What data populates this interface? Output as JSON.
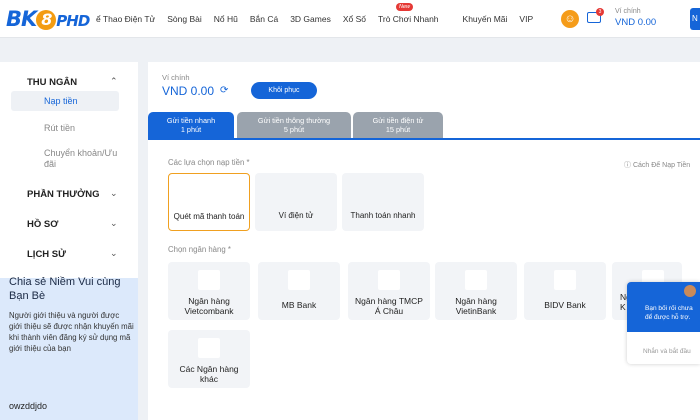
{
  "header": {
    "logo_a": "BK",
    "logo_eight": "8",
    "logo_b": "PHD",
    "nav": [
      "ể Thao Điện Tử",
      "Sòng Bài",
      "Nổ Hũ",
      "Bắn Cá",
      "3D Games",
      "Xổ Số",
      "Trò Chơi Nhanh",
      "Khuyến Mãi",
      "VIP"
    ],
    "new_badge": "New",
    "mail_count": "3",
    "balance_label": "Ví chính",
    "balance": "VND 0.00",
    "balance_btn": "N"
  },
  "sidebar": {
    "cashier": "THU NGÂN",
    "deposit": "Nạp tiền",
    "withdraw": "Rút tiền",
    "transfer_1": "Chuyển khoản/Ưu",
    "transfer_2": "đãi",
    "rewards": "PHẦN THƯỞNG",
    "profile": "HỒ SƠ",
    "history": "LỊCH SỬ",
    "promo_title": "Chia sẻ Niềm Vui cùng Bạn Bè",
    "promo_text": "Người giới thiệu và người được giới thiệu sẽ được nhận khuyến mãi khi thành viên đăng ký sử dụng mã giới thiệu của bạn",
    "promo_code": "owzddjdo"
  },
  "main": {
    "wallet_label": "Ví chính",
    "wallet_value": "VND 0.00",
    "restore_label": "Khôi phục",
    "tabs": [
      {
        "l1": "Gửi tiền nhanh",
        "l2": "1 phút"
      },
      {
        "l1": "Gửi tiền thông thường",
        "l2": "5 phút"
      },
      {
        "l1": "Gửi tiền điện tử",
        "l2": "15 phút"
      }
    ],
    "option_label": "Các lựa chọn nạp tiền *",
    "guide_label": "Cách Để Nạp Tiền",
    "options": [
      "Quét mã thanh toán",
      "Ví điện tử",
      "Thanh toán nhanh"
    ],
    "bank_label": "Chọn ngân hàng *",
    "banks": [
      [
        "Ngân hàng",
        "Vietcombank"
      ],
      [
        "MB Bank",
        ""
      ],
      [
        "Ngân hàng TMCP",
        "Á Châu"
      ],
      [
        "Ngân hàng",
        "VietinBank"
      ],
      [
        "BIDV Bank",
        ""
      ],
      [
        "Ng",
        "K"
      ],
      [
        "Các Ngân hàng",
        "khác"
      ]
    ]
  },
  "chat": {
    "msg": "Bạn bối rối chưa để được hỗ trợ.",
    "placeholder": "Nhắn và bắt đầu"
  }
}
